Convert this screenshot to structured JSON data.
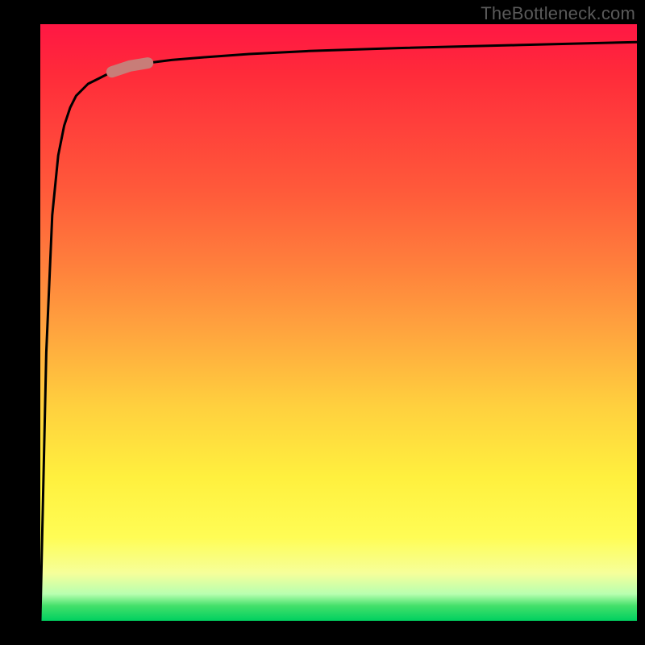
{
  "watermark": "TheBottleneck.com",
  "chart_data": {
    "type": "line",
    "title": "",
    "xlabel": "",
    "ylabel": "",
    "xlim": [
      0,
      100
    ],
    "ylim": [
      0,
      100
    ],
    "grid": false,
    "legend": false,
    "series": [
      {
        "name": "curve",
        "x": [
          0,
          1,
          2,
          3,
          4,
          5,
          6,
          8,
          10,
          12,
          15,
          18,
          22,
          28,
          35,
          45,
          60,
          80,
          100
        ],
        "values": [
          0,
          45,
          68,
          78,
          83,
          86,
          88,
          90,
          91,
          92,
          93,
          93.5,
          94,
          94.5,
          95,
          95.5,
          96,
          96.5,
          97
        ]
      }
    ],
    "highlight_segment": {
      "series": "curve",
      "x_start": 12,
      "x_end": 18,
      "color": "#c87d78"
    },
    "colors": {
      "gradient_top": "#ff1744",
      "gradient_mid": "#ffd03e",
      "gradient_bottom": "#00d060",
      "curve": "#000000",
      "highlight": "#c87d78"
    }
  }
}
